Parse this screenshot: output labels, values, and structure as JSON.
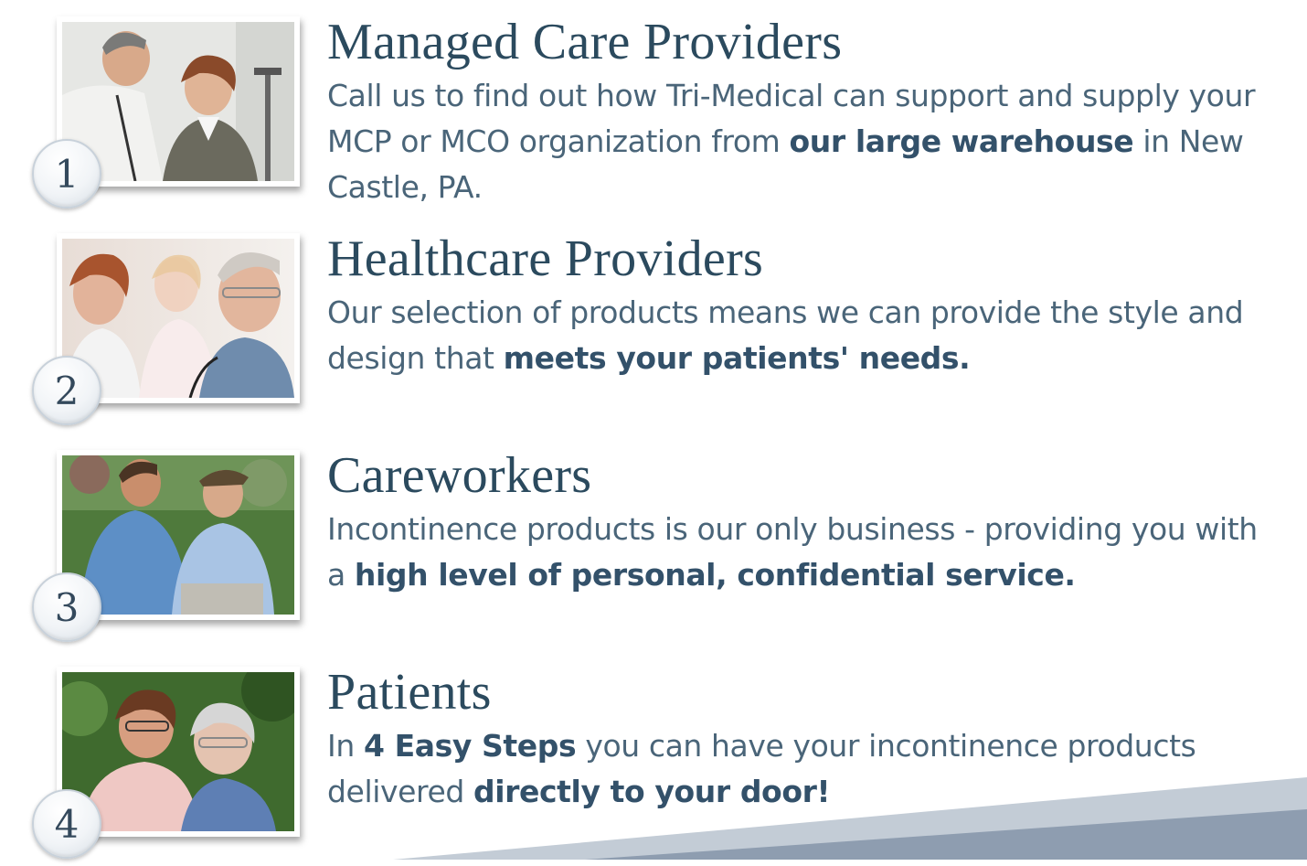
{
  "colors": {
    "heading": "#2b4a5e",
    "body": "#4a6579",
    "emphasis": "#33516a",
    "wedge_light": "#b8c3cf",
    "wedge_dark": "#7e8fa1"
  },
  "items": [
    {
      "number": "1",
      "title": "Managed Care Providers",
      "body_parts": [
        {
          "text": "Call us to find out how Tri-Medical can support and supply your MCP or MCO organization from ",
          "bold": false
        },
        {
          "text": "our large warehouse",
          "bold": true
        },
        {
          "text": " in New Castle, PA.",
          "bold": false
        }
      ]
    },
    {
      "number": "2",
      "title": "Healthcare Providers",
      "body_parts": [
        {
          "text": "Our selection of products means we can provide the style and design that ",
          "bold": false
        },
        {
          "text": "meets your patients' needs.",
          "bold": true
        }
      ]
    },
    {
      "number": "3",
      "title": "Careworkers",
      "body_parts": [
        {
          "text": "Incontinence products is our only business - providing you with a ",
          "bold": false
        },
        {
          "text": "high level of personal, confidential service.",
          "bold": true
        }
      ]
    },
    {
      "number": "4",
      "title": "Patients",
      "body_parts": [
        {
          "text": "In ",
          "bold": false
        },
        {
          "text": "4 Easy Steps",
          "bold": true
        },
        {
          "text": " you can have your incontinence products delivered ",
          "bold": false
        },
        {
          "text": "directly to your door!",
          "bold": true
        }
      ]
    }
  ]
}
